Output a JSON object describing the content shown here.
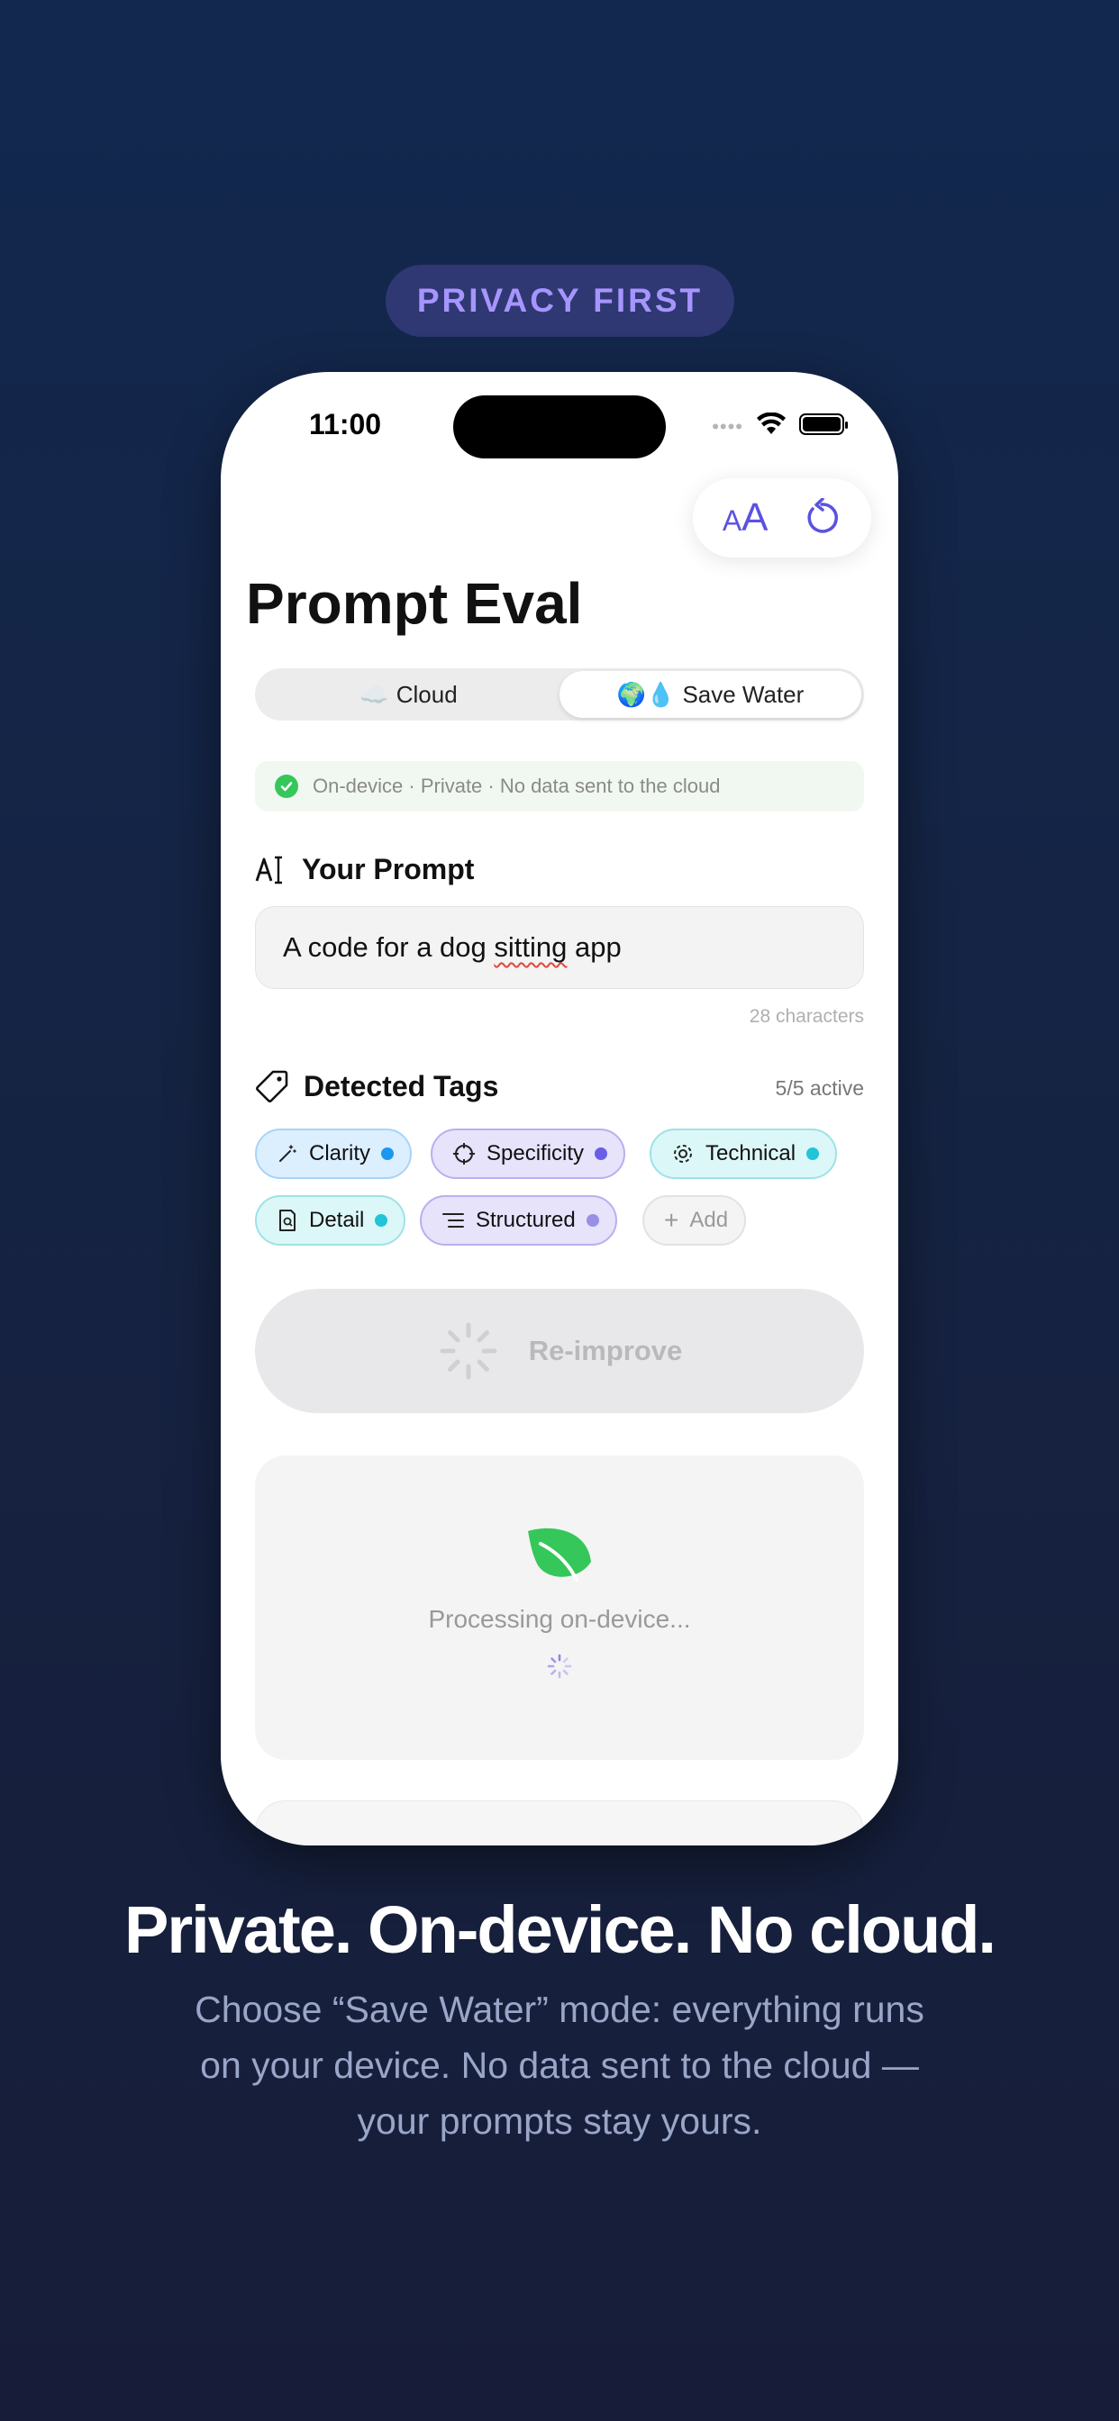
{
  "badge": "PRIVACY FIRST",
  "status": {
    "time": "11:00"
  },
  "toolbar": {
    "text_size_icon": "text-size-icon",
    "refresh_icon": "refresh-icon"
  },
  "app": {
    "title": "Prompt Eval"
  },
  "mode": {
    "cloud_icon": "☁️",
    "cloud_label": "Cloud",
    "water_icons": "🌍💧",
    "water_label": "Save Water",
    "selected": "Save Water"
  },
  "notice": {
    "text": "On-device · Private · No data sent to the cloud"
  },
  "prompt": {
    "header": "Your Prompt",
    "value_before": "A code for a dog ",
    "value_misspelled": "sitting",
    "value_after": " app",
    "char_count": "28 characters"
  },
  "tags": {
    "header": "Detected Tags",
    "active_count": "5/5 active",
    "items": [
      {
        "label": "Clarity",
        "color": "#1a98f0"
      },
      {
        "label": "Specificity",
        "color": "#6b5ee6"
      },
      {
        "label": "Technical",
        "color": "#22c4d8"
      },
      {
        "label": "Detail",
        "color": "#22c4d8"
      },
      {
        "label": "Structured",
        "color": "#9a8fe6"
      }
    ],
    "add_label": "Add"
  },
  "actions": {
    "reimprove": "Re-improve"
  },
  "processing": {
    "text": "Processing on-device...",
    "accent": "#35c759"
  },
  "marketing": {
    "headline": "Private. On-device. No cloud.",
    "subtext": "Choose “Save Water” mode: everything runs on your device. No data sent to the cloud — your prompts stay yours."
  }
}
